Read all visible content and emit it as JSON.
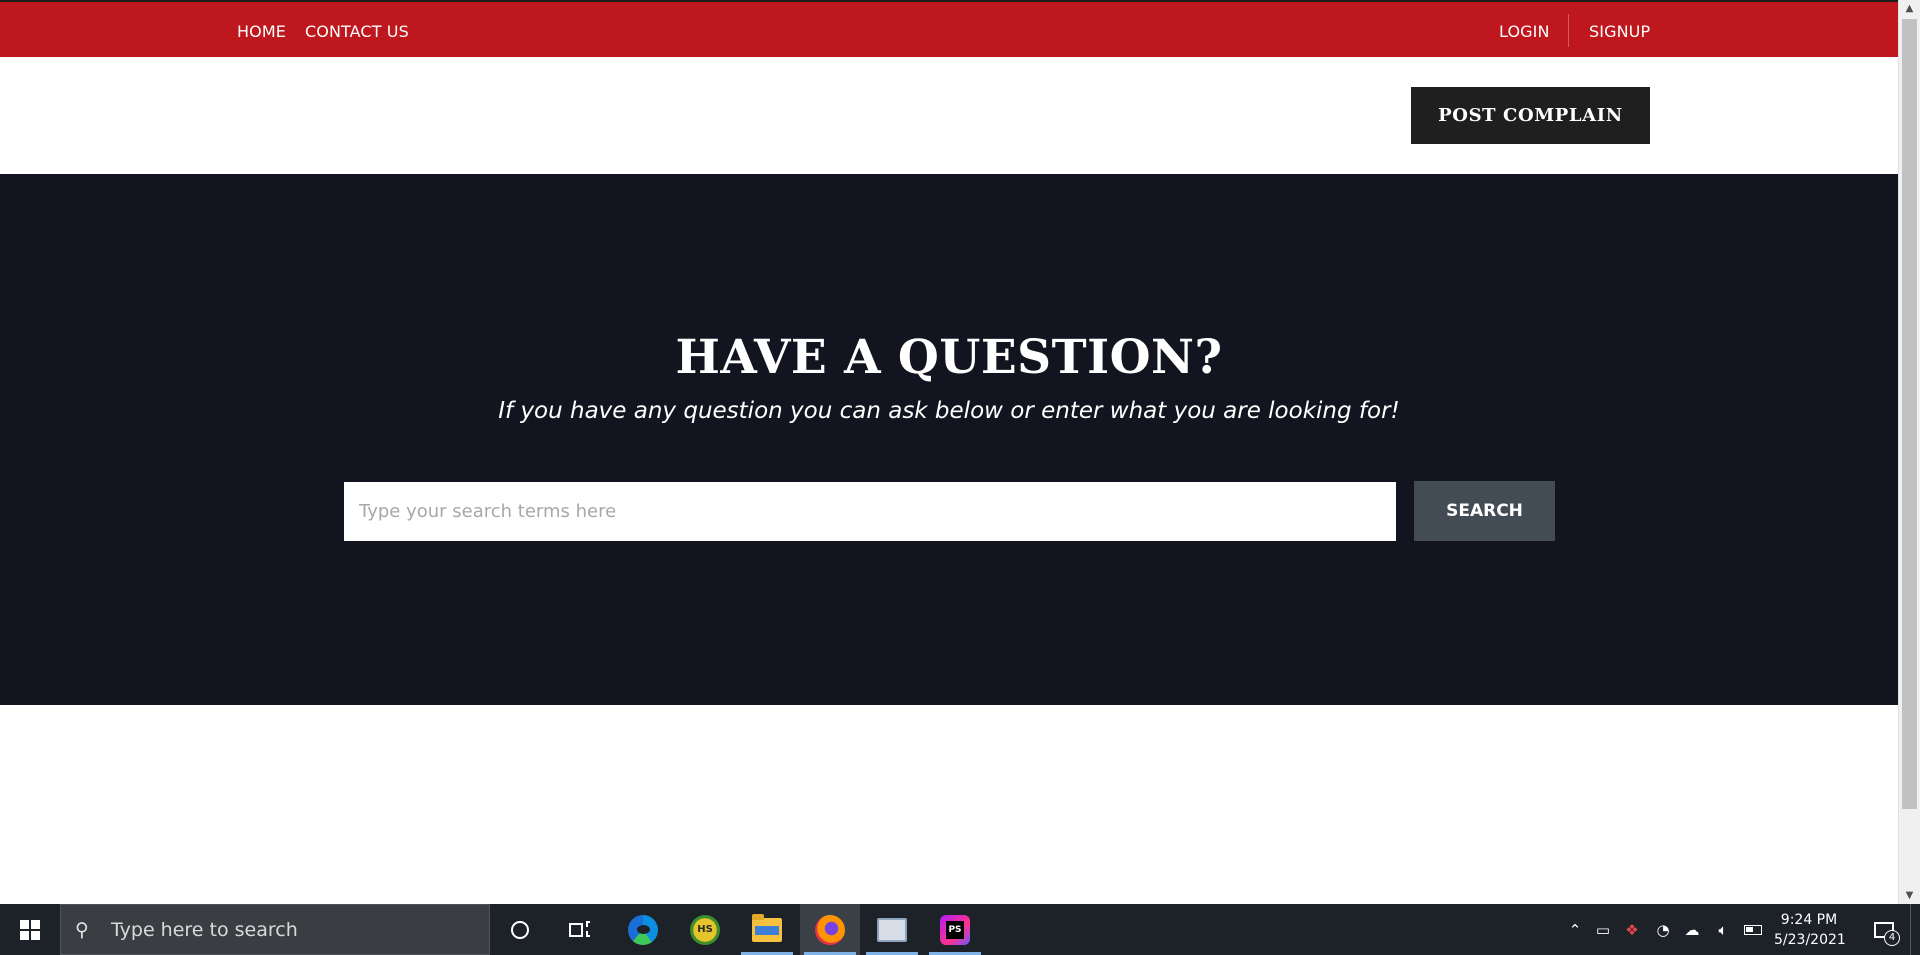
{
  "nav": {
    "home": "HOME",
    "contact": "CONTACT US",
    "login": "LOGIN",
    "signup": "SIGNUP"
  },
  "header": {
    "post_button": "POST COMPLAIN"
  },
  "hero": {
    "title": "HAVE A QUESTION?",
    "subtitle": "If you have any question you can ask below or enter what you are looking for!",
    "search_placeholder": "Type your search terms here",
    "search_value": "",
    "search_button": "SEARCH"
  },
  "colors": {
    "topbar": "#be171e",
    "hero_bg": "#12141f",
    "post_button_bg": "#1f1f1f",
    "search_button_bg": "#434c55"
  },
  "taskbar": {
    "search_placeholder": "Type here to search",
    "apps": [
      "cortana-icon",
      "task-view-icon",
      "edge-icon",
      "hs-icon",
      "file-explorer-icon",
      "firefox-icon",
      "remote-desktop-icon",
      "phpstorm-icon"
    ],
    "hs_label": "HS",
    "phpstorm_label": "PS",
    "time": "9:24 PM",
    "date": "5/23/2021",
    "notification_count": "4"
  }
}
